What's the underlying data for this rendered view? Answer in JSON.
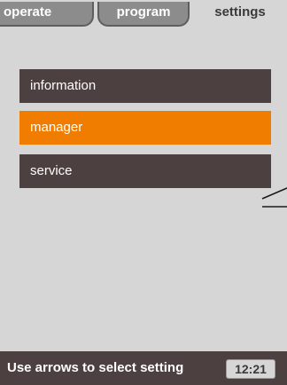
{
  "tabs": {
    "operate": "operate",
    "program": "program",
    "settings": "settings",
    "active": "settings"
  },
  "menu": {
    "items": [
      {
        "label": "information",
        "state": "normal"
      },
      {
        "label": "manager",
        "state": "selected"
      },
      {
        "label": "service",
        "state": "normal"
      }
    ]
  },
  "status": {
    "hint": "Use arrows to select setting",
    "time": "12:21"
  },
  "colors": {
    "background": "#d6d6d6",
    "item_dark": "#4d4040",
    "item_selected": "#f07d00",
    "tab_inactive": "#8c8c8c"
  }
}
